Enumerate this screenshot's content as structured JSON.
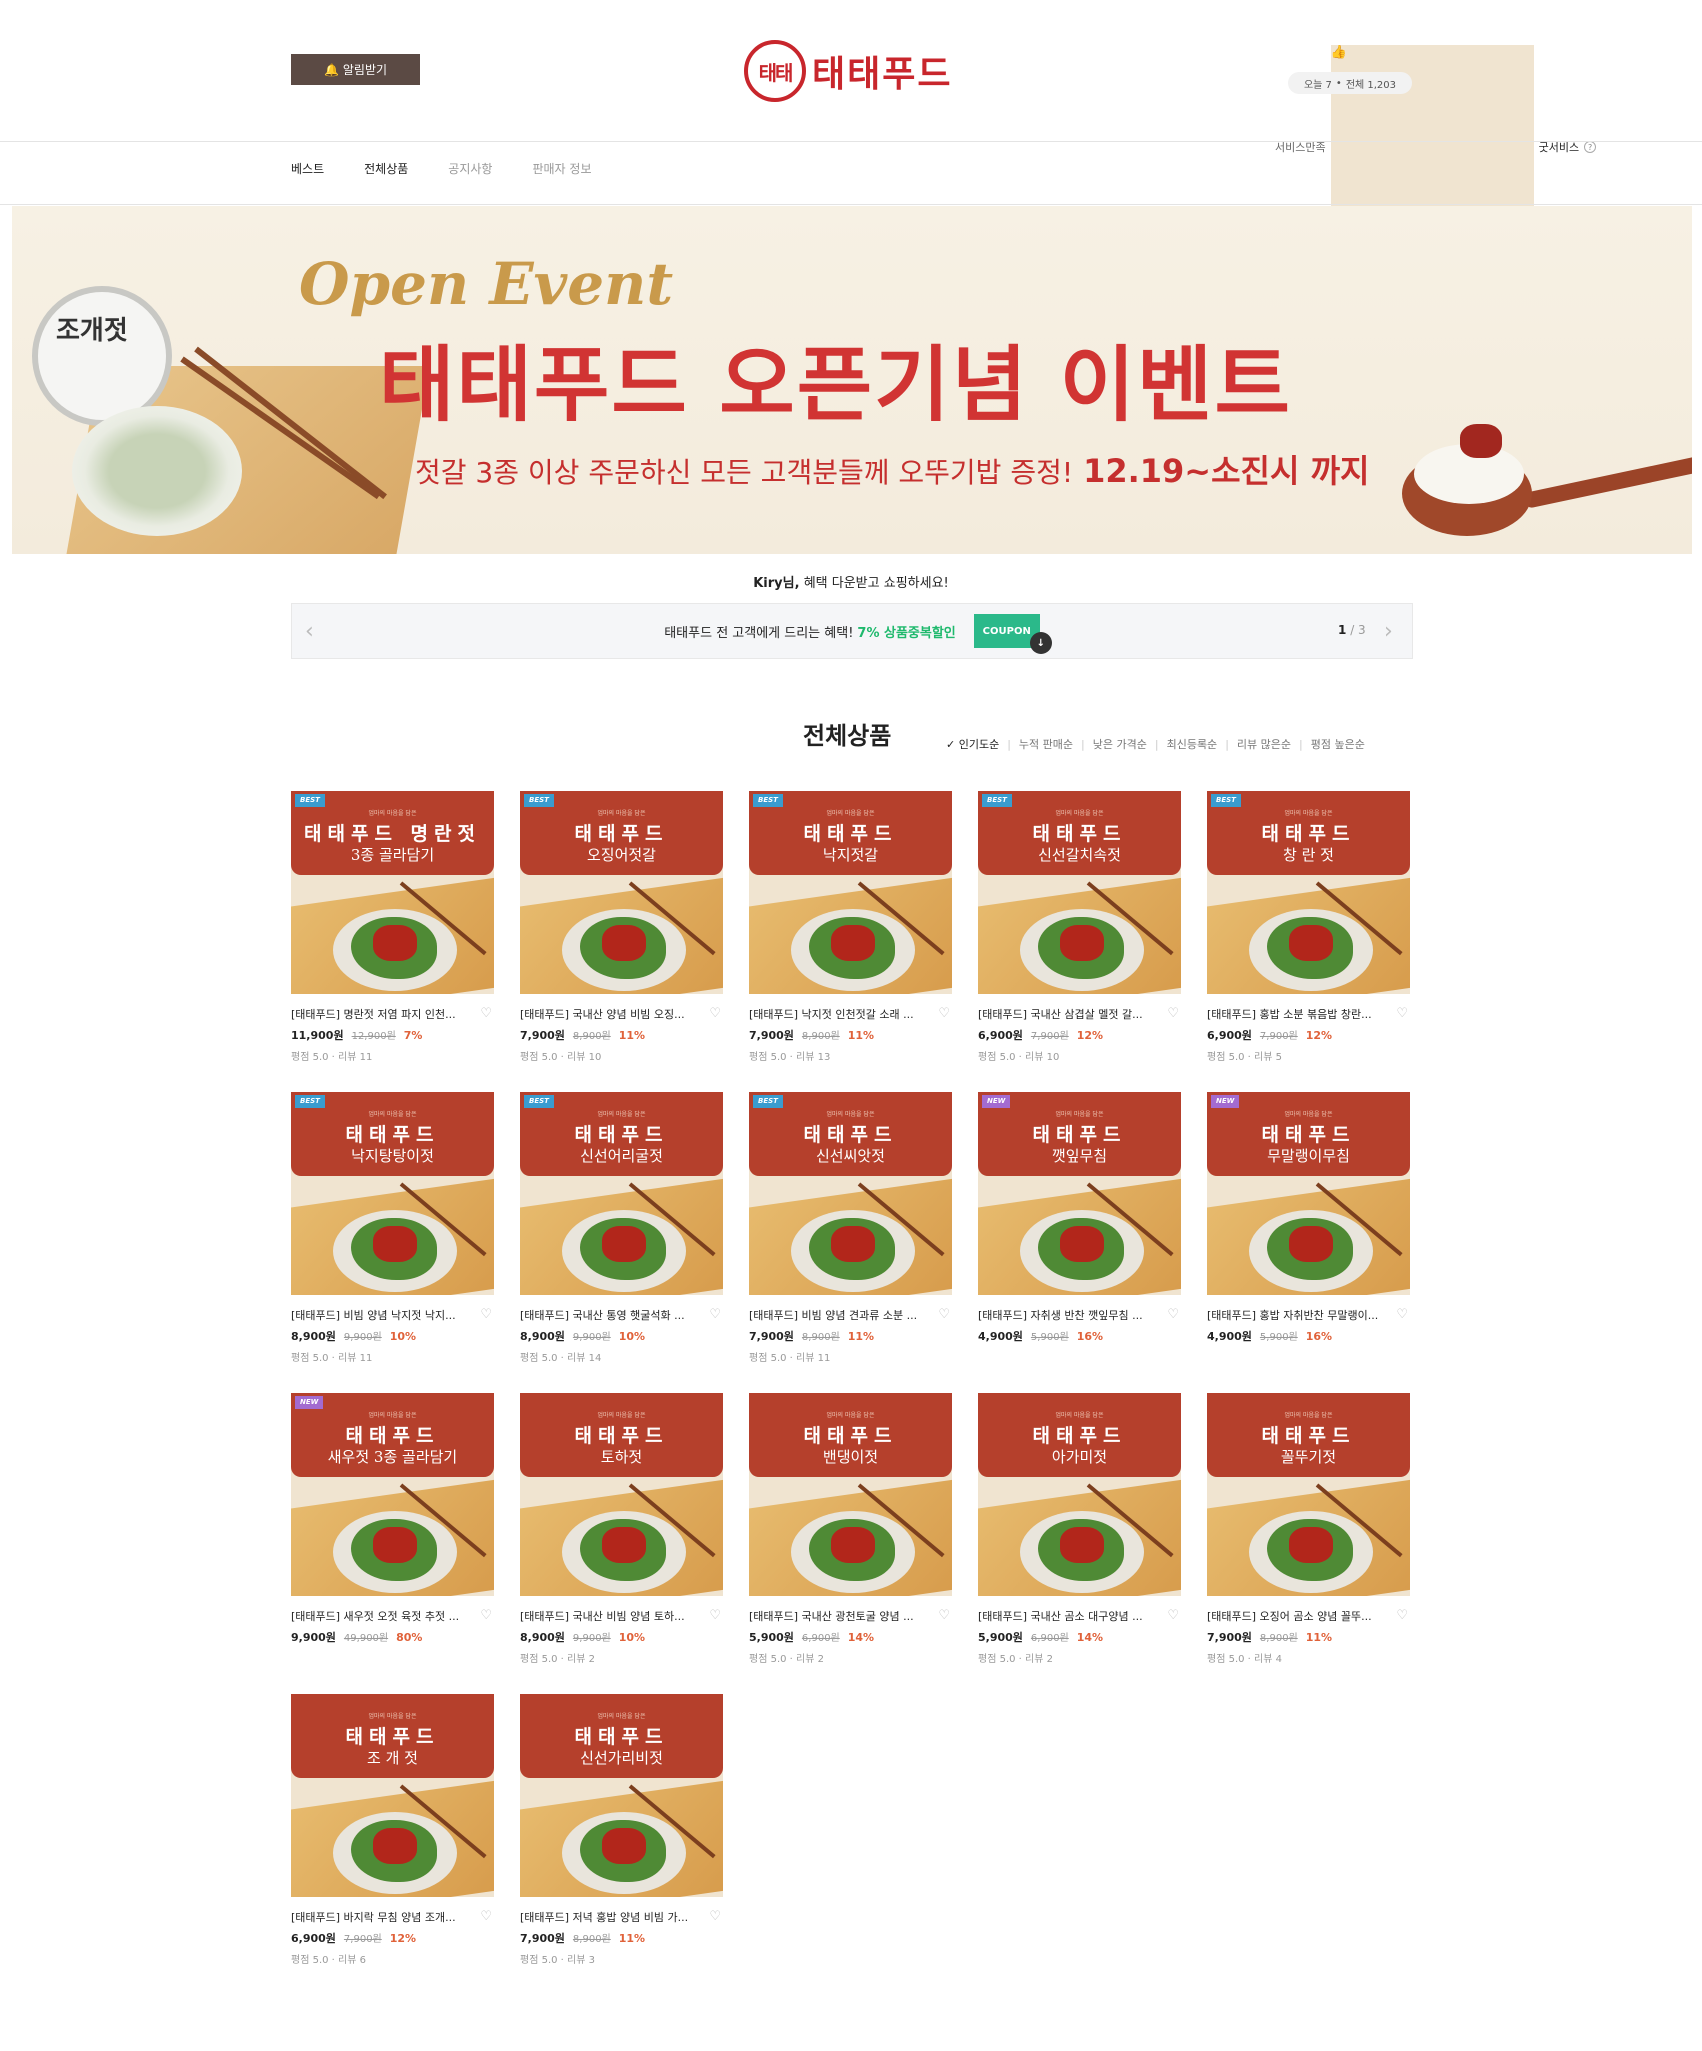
{
  "header": {
    "alarm_label": "알림받기",
    "logo_mark": "태태",
    "logo_text": "태태푸드",
    "service_label": "서비스만족",
    "service_grade": "굿서비스",
    "visits_today": "오늘 7",
    "visits_total": "전체 1,203"
  },
  "nav": {
    "items": [
      "베스트",
      "전체상품",
      "공지사항",
      "판매자 정보"
    ]
  },
  "banner": {
    "script_title": "Open Event",
    "title": "태태푸드 오픈기념 이벤트",
    "subtitle": "젓갈 3종 이상 주문하신 모든 고객분들께 오뚜기밥 증정!",
    "period": "12.19~소진시 까지",
    "jar_label": "조개젓"
  },
  "welcome": {
    "user": "Kiry님,",
    "message": "혜택 다운받고 쇼핑하세요!"
  },
  "coupon": {
    "text": "태태푸드 전 고객에게 드리는 혜택!",
    "highlight": "7% 상품중복할인",
    "button": "COUPON",
    "page_current": "1",
    "page_total": "/ 3"
  },
  "section": {
    "title": "전체상품",
    "sorts": [
      "인기도순",
      "누적 판매순",
      "낮은 가격순",
      "최신등록순",
      "리뷰 많은순",
      "평점 높은순"
    ]
  },
  "colors": {
    "brand_red": "#c8262c",
    "thumb_header": "#b5402c",
    "discount": "#e0623a",
    "coupon_green": "#1fb96d",
    "best_badge": "#3a9ccf",
    "new_badge": "#a36bd0"
  },
  "products": [
    {
      "badge": "BEST",
      "slogan": "엄마의 마음을 담은",
      "brand": "태태푸드 명란젓",
      "name": "3종 골라담기",
      "title": "[태태푸드] 명란젓 저염 파지 인천...",
      "price": "11,900원",
      "orig": "12,900원",
      "disc": "7%",
      "review": "평점 5.0 · 리뷰 11"
    },
    {
      "badge": "BEST",
      "slogan": "엄마의 마음을 담은",
      "brand": "태태푸드",
      "name": "오징어젓갈",
      "title": "[태태푸드] 국내산 양념 비빔 오징...",
      "price": "7,900원",
      "orig": "8,900원",
      "disc": "11%",
      "review": "평점 5.0 · 리뷰 10"
    },
    {
      "badge": "BEST",
      "slogan": "엄마의 마음을 담은",
      "brand": "태태푸드",
      "name": "낙지젓갈",
      "title": "[태태푸드] 낙지젓 인천젓갈 소래 ...",
      "price": "7,900원",
      "orig": "8,900원",
      "disc": "11%",
      "review": "평점 5.0 · 리뷰 13"
    },
    {
      "badge": "BEST",
      "slogan": "엄마의 마음을 담은",
      "brand": "태태푸드",
      "name": "신선갈치속젓",
      "title": "[태태푸드] 국내산 삼겹살 멜젓 갈...",
      "price": "6,900원",
      "orig": "7,900원",
      "disc": "12%",
      "review": "평점 5.0 · 리뷰 10"
    },
    {
      "badge": "BEST",
      "slogan": "엄마의 마음을 담은",
      "brand": "태태푸드",
      "name": "창 란 젓",
      "title": "[태태푸드] 홍밥 소분 볶음밥 창란...",
      "price": "6,900원",
      "orig": "7,900원",
      "disc": "12%",
      "review": "평점 5.0 · 리뷰 5"
    },
    {
      "badge": "BEST",
      "slogan": "엄마의 마음을 담은",
      "brand": "태태푸드",
      "name": "낙지탕탕이젓",
      "title": "[태태푸드] 비빔 양념 낙지젓 낙지...",
      "price": "8,900원",
      "orig": "9,900원",
      "disc": "10%",
      "review": "평점 5.0 · 리뷰 11"
    },
    {
      "badge": "BEST",
      "slogan": "엄마의 마음을 담은",
      "brand": "태태푸드",
      "name": "신선어리굴젓",
      "title": "[태태푸드] 국내산 통영 햇굴석화 ...",
      "price": "8,900원",
      "orig": "9,900원",
      "disc": "10%",
      "review": "평점 5.0 · 리뷰 14"
    },
    {
      "badge": "BEST",
      "slogan": "엄마의 마음을 담은",
      "brand": "태태푸드",
      "name": "신선씨앗젓",
      "title": "[태태푸드] 비빔 양념 견과류 소분 ...",
      "price": "7,900원",
      "orig": "8,900원",
      "disc": "11%",
      "review": "평점 5.0 · 리뷰 11"
    },
    {
      "badge": "NEW",
      "slogan": "엄마의 마음을 담은",
      "brand": "태태푸드",
      "name": "깻잎무침",
      "title": "[태태푸드] 자취생 반찬 깻잎무침 ...",
      "price": "4,900원",
      "orig": "5,900원",
      "disc": "16%",
      "review": ""
    },
    {
      "badge": "NEW",
      "slogan": "엄마의 마음을 담은",
      "brand": "태태푸드",
      "name": "무말랭이무침",
      "title": "[태태푸드] 홍밥 자취반찬 무말랭이...",
      "price": "4,900원",
      "orig": "5,900원",
      "disc": "16%",
      "review": ""
    },
    {
      "badge": "NEW",
      "slogan": "엄마의 마음을 담은",
      "brand": "태태푸드",
      "name": "새우젓 3종 골라담기",
      "title": "[태태푸드] 새우젓 오젓 육젓 추젓 ...",
      "price": "9,900원",
      "orig": "49,900원",
      "disc": "80%",
      "review": ""
    },
    {
      "badge": "",
      "slogan": "엄마의 마음을 담은",
      "brand": "태태푸드",
      "name": "토하젓",
      "title": "[태태푸드] 국내산 비빔 양념 토하...",
      "price": "8,900원",
      "orig": "9,900원",
      "disc": "10%",
      "review": "평점 5.0 · 리뷰 2"
    },
    {
      "badge": "",
      "slogan": "엄마의 마음을 담은",
      "brand": "태태푸드",
      "name": "밴댕이젓",
      "title": "[태태푸드] 국내산 광천토굴 양념 ...",
      "price": "5,900원",
      "orig": "6,900원",
      "disc": "14%",
      "review": "평점 5.0 · 리뷰 2"
    },
    {
      "badge": "",
      "slogan": "엄마의 마음을 담은",
      "brand": "태태푸드",
      "name": "아가미젓",
      "title": "[태태푸드] 국내산 곰소 대구양념 ...",
      "price": "5,900원",
      "orig": "6,900원",
      "disc": "14%",
      "review": "평점 5.0 · 리뷰 2"
    },
    {
      "badge": "",
      "slogan": "엄마의 마음을 담은",
      "brand": "태태푸드",
      "name": "꼴뚜기젓",
      "title": "[태태푸드] 오징어 곰소 양념 꼴뚜...",
      "price": "7,900원",
      "orig": "8,900원",
      "disc": "11%",
      "review": "평점 5.0 · 리뷰 4"
    },
    {
      "badge": "",
      "slogan": "엄마의 마음을 담은",
      "brand": "태태푸드",
      "name": "조 개 젓",
      "title": "[태태푸드] 바지락 무침 양념 조개...",
      "price": "6,900원",
      "orig": "7,900원",
      "disc": "12%",
      "review": "평점 5.0 · 리뷰 6"
    },
    {
      "badge": "",
      "slogan": "엄마의 마음을 담은",
      "brand": "태태푸드",
      "name": "신선가리비젓",
      "title": "[태태푸드] 저녁 홍밥 양념 비빔 가...",
      "price": "7,900원",
      "orig": "8,900원",
      "disc": "11%",
      "review": "평점 5.0 · 리뷰 3"
    }
  ]
}
